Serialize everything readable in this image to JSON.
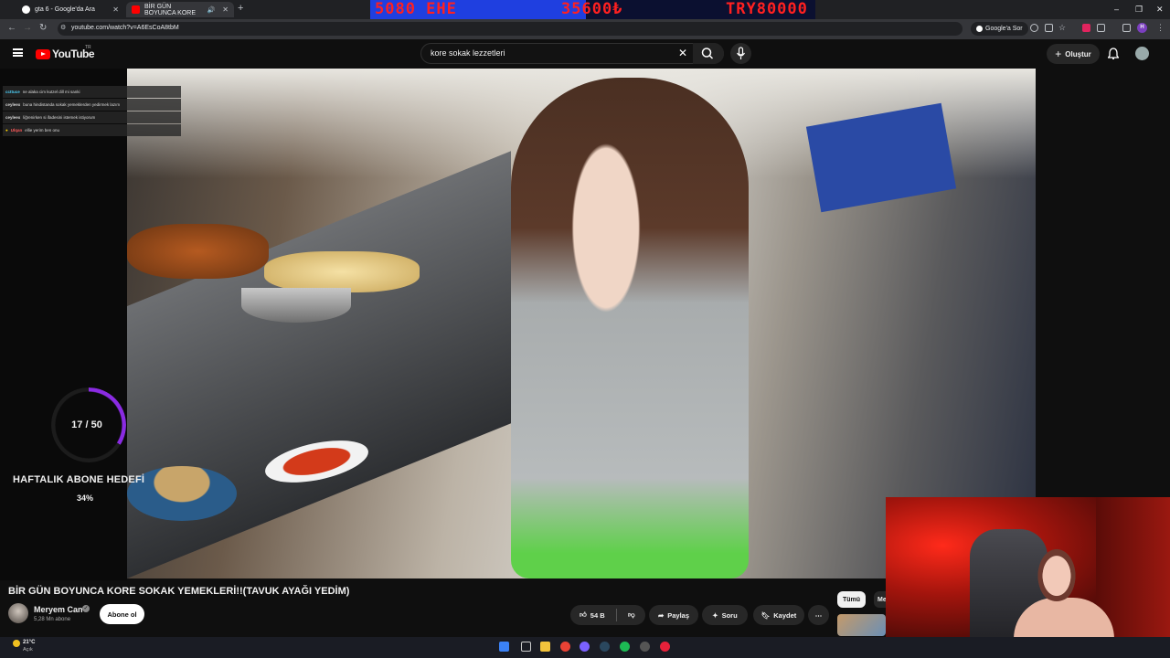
{
  "browser": {
    "tabs": [
      {
        "title": "gta 6 - Google'da Ara",
        "icon": "google-icon",
        "active": false
      },
      {
        "title": "BİR GÜN BOYUNCA KORE",
        "icon": "youtube-icon",
        "active": true
      }
    ],
    "url": "youtube.com/watch?v=A6EsCoA8tbM",
    "google_sor": "Google'a Sor",
    "profile_letter": "H"
  },
  "stream_overlay": {
    "left_text": "5080 EHE",
    "mid_text": "35600₺",
    "right_text": "TRY80000"
  },
  "youtube": {
    "logo_text": "YouTube",
    "logo_region": "TR",
    "search_query": "kore sokak lezzetleri",
    "create_label": "Oluştur"
  },
  "chat": [
    {
      "user": "ccttuce",
      "message": "ne alaka cim kutzel dill mi sanki",
      "color": "#4fd6ff"
    },
    {
      "user": "ceyleex",
      "message": "buna hindistanda sokak yemeklerden yedirmek lazım",
      "color": "#ffffff"
    },
    {
      "user": "ceyleex",
      "message": "liğrenirken si ifadesini istemek istiyorum",
      "color": "#ffffff"
    },
    {
      "user": "Ulqan",
      "message": "ellie yerim ben onu",
      "color": "#ff5a5a"
    }
  ],
  "goal": {
    "count_text": "17 / 50",
    "progress": 0.34,
    "title": "HAFTALIK ABONE HEDEFİ",
    "percent_text": "34%"
  },
  "video": {
    "title": "BİR GÜN BOYUNCA KORE SOKAK YEMEKLERİ!!(TAVUK AYAĞI YEDİM)",
    "channel": "Meryem Can",
    "subscribers": "5,28 Mn abone",
    "subscribe_label": "Abone ol",
    "likes": "54 B",
    "share_label": "Paylaş",
    "ask_label": "Soru",
    "save_label": "Kaydet"
  },
  "side_chips": {
    "all_label": "Tümü",
    "next_label": "Me"
  },
  "taskbar": {
    "temperature": "21°C",
    "weather": "Açık"
  },
  "colors": {
    "youtube_red": "#ff0000",
    "ring_purple": "#8a2be2",
    "overlay_red": "#ff2020",
    "overlay_blue": "#1f3fe0"
  }
}
